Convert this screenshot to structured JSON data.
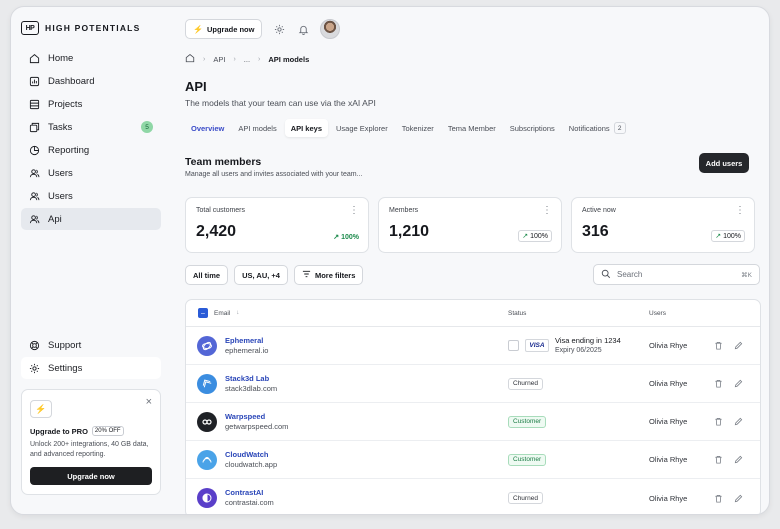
{
  "brand": {
    "logo_mark": "HP",
    "name": "HIGH POTENTIALS"
  },
  "sidebar": {
    "items": [
      {
        "label": "Home",
        "icon": "home-icon"
      },
      {
        "label": "Dashboard",
        "icon": "dashboard-icon"
      },
      {
        "label": "Projects",
        "icon": "projects-icon"
      },
      {
        "label": "Tasks",
        "icon": "tasks-icon",
        "badge": "5"
      },
      {
        "label": "Reporting",
        "icon": "pie-chart-icon"
      },
      {
        "label": "Users",
        "icon": "users-icon"
      },
      {
        "label": "Users",
        "icon": "users-icon"
      },
      {
        "label": "Api",
        "icon": "users-icon",
        "active": true
      }
    ],
    "bottom": [
      {
        "label": "Support",
        "icon": "support-icon"
      },
      {
        "label": "Settings",
        "icon": "gear-icon"
      }
    ],
    "promo": {
      "icon": "lightning-icon",
      "title": "Upgrade to PRO",
      "tag": "20% OFF",
      "description": "Unlock 200+ integrations, 40 GB data, and advanced reporting.",
      "button": "Upgrade now"
    }
  },
  "topbar": {
    "upgrade_label": "Upgrade now"
  },
  "breadcrumb": {
    "items": [
      "API",
      "...",
      "API models"
    ]
  },
  "page": {
    "title": "API",
    "subtitle": "The models that your team can use via the xAI API"
  },
  "tabs": [
    {
      "label": "Overview"
    },
    {
      "label": "API models"
    },
    {
      "label": "API keys",
      "selected": true
    },
    {
      "label": "Usage Explorer"
    },
    {
      "label": "Tokenizer"
    },
    {
      "label": "Tema Member"
    },
    {
      "label": "Subscriptions"
    },
    {
      "label": "Notifications",
      "count": "2"
    }
  ],
  "team": {
    "title": "Team members",
    "subtitle": "Manage all users and invites associated with your team...",
    "add_label": "Add users"
  },
  "stats": [
    {
      "label": "Total customers",
      "value": "2,420",
      "change": "100%"
    },
    {
      "label": "Members",
      "value": "1,210",
      "change": "100%"
    },
    {
      "label": "Active now",
      "value": "316",
      "change": "100%"
    }
  ],
  "filters": {
    "time": "All time",
    "region": "US, AU, +4",
    "more": "More filters"
  },
  "search": {
    "placeholder": "Search",
    "shortcut": "⌘K"
  },
  "table": {
    "headers": {
      "email": "Email",
      "status": "Status",
      "users": "Users"
    },
    "rows": [
      {
        "name": "Ephemeral",
        "domain": "ephemeral.io",
        "status_type": "visa",
        "visa_brand": "VISA",
        "visa_line1": "Visa ending in 1234",
        "visa_line2": "Expiry 06/2025",
        "user": "Olivia Rhye",
        "logo_color": "#5366d6"
      },
      {
        "name": "Stack3d Lab",
        "domain": "stack3dlab.com",
        "status_type": "pill",
        "status": "Churned",
        "user": "Olivia Rhye",
        "logo_color": "#3b8de0"
      },
      {
        "name": "Warpspeed",
        "domain": "getwarpspeed.com",
        "status_type": "pill-green",
        "status": "Customer",
        "user": "Olivia Rhye",
        "logo_color": "#1f2126"
      },
      {
        "name": "CloudWatch",
        "domain": "cloudwatch.app",
        "status_type": "pill-green",
        "status": "Customer",
        "user": "Olivia Rhye",
        "logo_color": "#4aa3e8"
      },
      {
        "name": "ContrastAI",
        "domain": "contrastai.com",
        "status_type": "pill",
        "status": "Churned",
        "user": "Olivia Rhye",
        "logo_color": "#5a3fc9"
      }
    ]
  }
}
